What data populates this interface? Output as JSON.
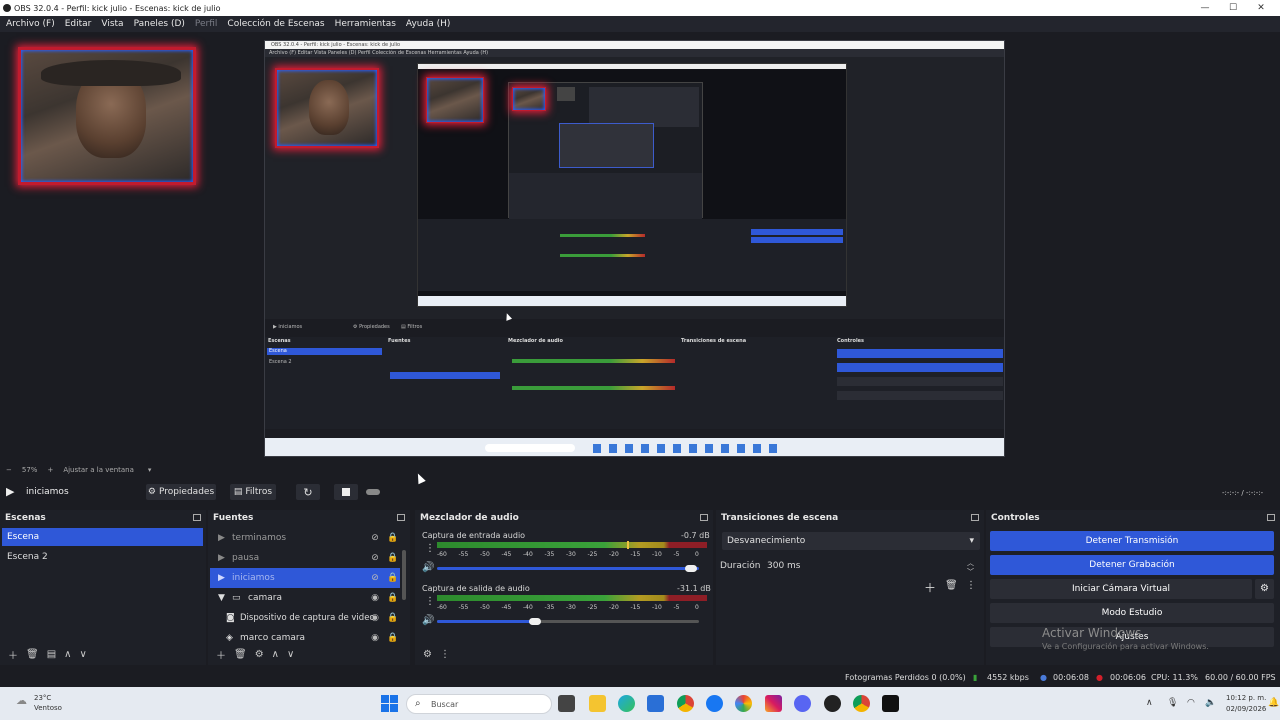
{
  "window": {
    "title": "OBS 32.0.4 - Perfil: kick julio - Escenas: kick de julio",
    "controls": [
      "—",
      "☐",
      "✕"
    ]
  },
  "menu": {
    "items": [
      "Archivo (F)",
      "Editar",
      "Vista",
      "Paneles (D)",
      "Perfil",
      "Colección de Escenas",
      "Herramientas",
      "Ayuda (H)"
    ]
  },
  "zoom": {
    "percent": "57%",
    "fit_label": "Ajustar a la ventana"
  },
  "toolbar": {
    "scene_name": "iniciamos",
    "properties_label": "Propiedades",
    "filters_label": "Filtros",
    "timecode": "-:-:-:- / -:-:-:-"
  },
  "scenes": {
    "header": "Escenas",
    "items": [
      "Escena",
      "Escena 2"
    ],
    "selected_index": 0
  },
  "sources": {
    "header": "Fuentes",
    "items": [
      {
        "label": "terminamos",
        "indent": 0,
        "icon": "play-icon",
        "hidden": true
      },
      {
        "label": "pausa",
        "indent": 0,
        "icon": "play-icon",
        "hidden": true
      },
      {
        "label": "iniciamos",
        "indent": 0,
        "icon": "play-icon",
        "hidden": true,
        "selected": true
      },
      {
        "label": "camara",
        "indent": 1,
        "icon": "folder-icon",
        "hidden": false
      },
      {
        "label": "Dispositivo de captura de video",
        "indent": 2,
        "icon": "camera-icon",
        "hidden": false
      },
      {
        "label": "marco camara",
        "indent": 2,
        "icon": "image-icon",
        "hidden": false
      }
    ]
  },
  "mixer": {
    "header": "Mezclador de audio",
    "tracks": [
      {
        "name": "Captura de entrada audio",
        "db": "-0.7 dB",
        "level": 0.9
      },
      {
        "name": "Captura de salida de audio",
        "db": "-31.1 dB",
        "level": 0.35
      }
    ],
    "ticks": [
      "-60",
      "-55",
      "-50",
      "-45",
      "-40",
      "-35",
      "-30",
      "-25",
      "-20",
      "-15",
      "-10",
      "-5",
      "0"
    ]
  },
  "transitions": {
    "header": "Transiciones de escena",
    "selected": "Desvanecimiento",
    "duration_label": "Duración",
    "duration_value": "300 ms"
  },
  "controls": {
    "header": "Controles",
    "stop_stream": "Detener Transmisión",
    "stop_record": "Detener Grabación",
    "virtual_cam": "Iniciar Cámara Virtual",
    "studio_mode": "Modo Estudio",
    "settings": "Ajustes"
  },
  "watermark": {
    "line1": "Activar Windows",
    "line2": "Ve a Configuración para activar Windows."
  },
  "status": {
    "dropped_frames": "Fotogramas Perdidos 0 (0.0%)",
    "bitrate": "4552 kbps",
    "stream_time": "00:06:08",
    "record_time": "00:06:06",
    "cpu": "CPU: 11.3%",
    "fps": "60.00 / 60.00 FPS"
  },
  "taskbar": {
    "weather_temp": "23°C",
    "weather_desc": "Ventoso",
    "search_placeholder": "Buscar",
    "time": "10:12 p. m.",
    "date": "02/09/2026"
  },
  "nested_preview": {
    "title": "OBS 32.0.4 - Perfil: kick julio - Escenas: kick de julio",
    "menu": "Archivo (F)   Editar   Vista   Paneles (D)   Perfil   Colección de Escenas   Herramientas   Ayuda (H)"
  },
  "colors": {
    "accent_blue": "#2f58d8",
    "panel_bg": "#1e2027",
    "app_bg": "#1b1c22",
    "record_red": "#d21f2a"
  }
}
